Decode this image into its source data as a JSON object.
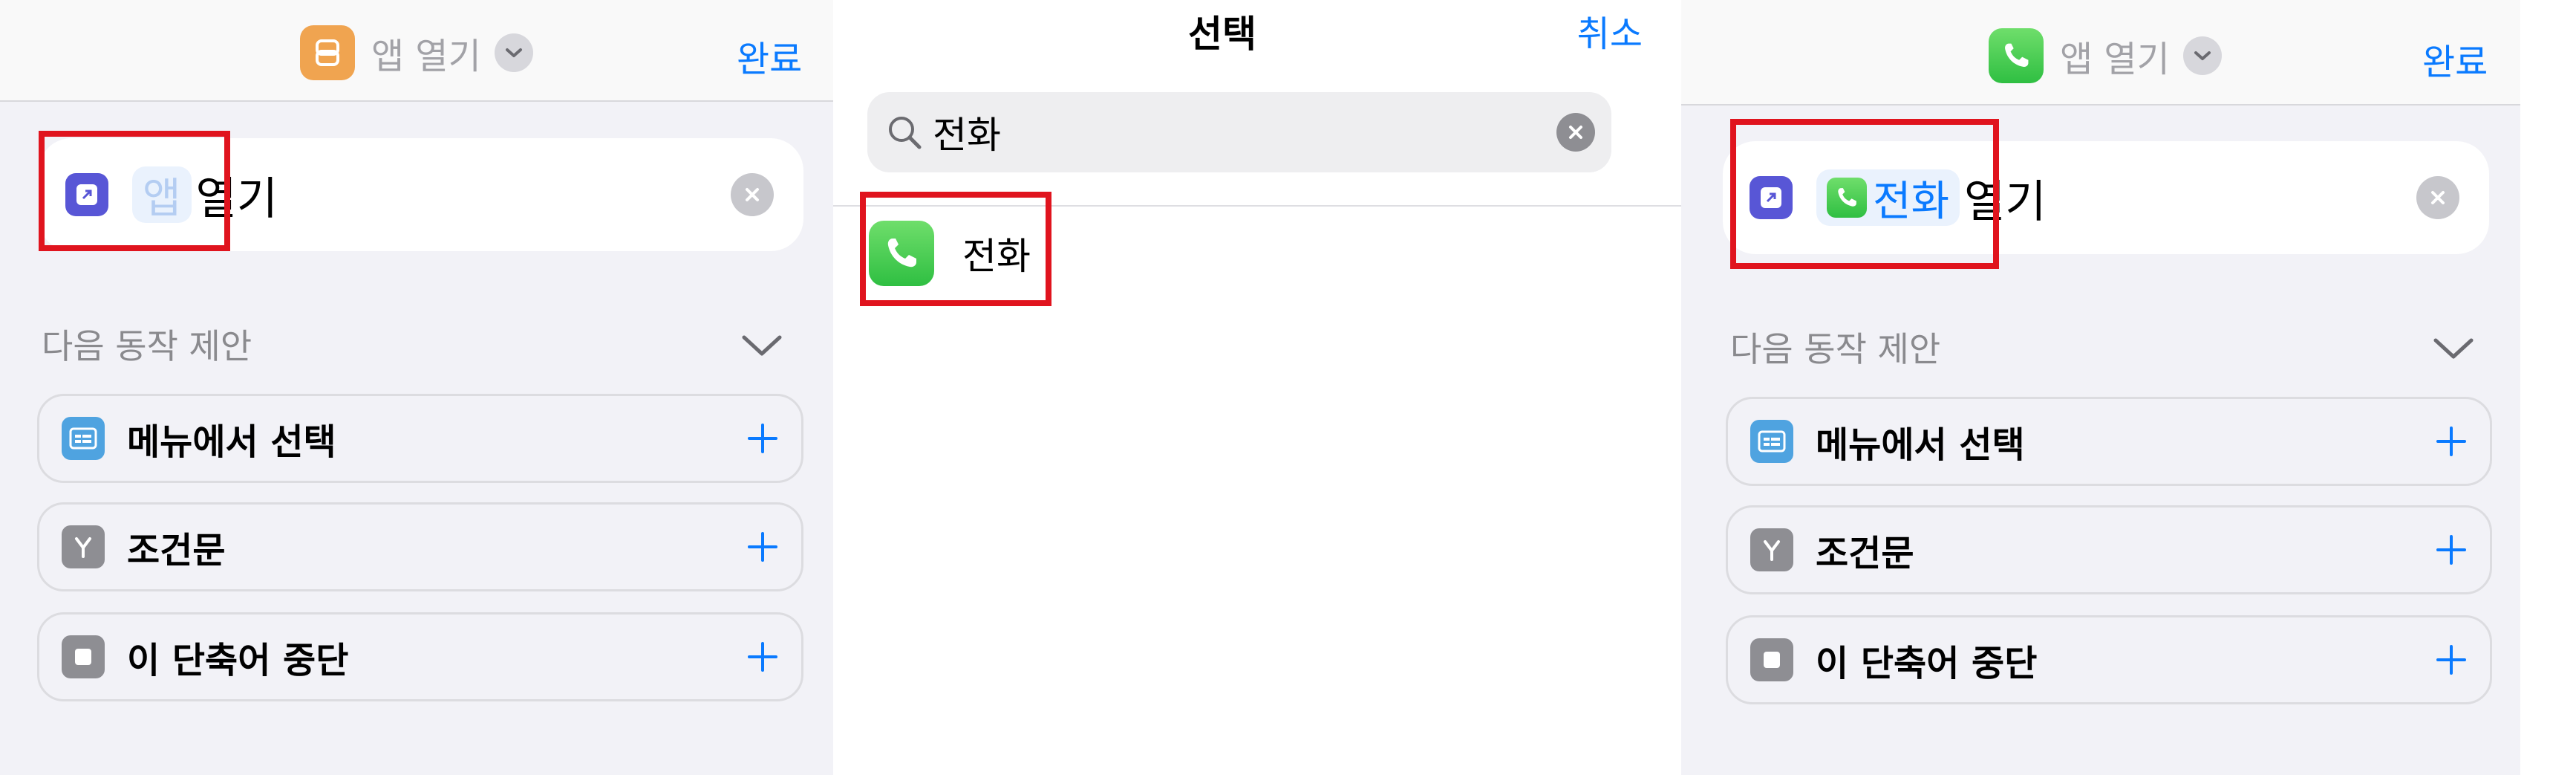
{
  "colors": {
    "accent": "#0a7aff",
    "highlight": "#e0141e",
    "shortcut_icon": "#5856d6"
  },
  "panel_before": {
    "nav": {
      "app_icon": "shortcuts-app-icon",
      "title": "앱 열기",
      "done": "완료"
    },
    "action": {
      "icon": "open-app-icon",
      "token": "앱",
      "text": "열기"
    },
    "suggestions_title": "다음 동작 제안",
    "suggestions": [
      {
        "icon": "menu-icon",
        "label": "메뉴에서 선택"
      },
      {
        "icon": "branch-icon",
        "label": "조건문"
      },
      {
        "icon": "stop-icon",
        "label": "이 단축어 중단"
      }
    ]
  },
  "panel_search": {
    "title": "선택",
    "cancel": "취소",
    "search": {
      "value": "전화",
      "placeholder": ""
    },
    "results": [
      {
        "icon": "phone-app-icon",
        "label": "전화"
      }
    ]
  },
  "panel_after": {
    "nav": {
      "app_icon": "phone-app-icon",
      "title": "앱 열기",
      "done": "완료"
    },
    "action": {
      "icon": "open-app-icon",
      "token": "전화",
      "text": "열기"
    },
    "suggestions_title": "다음 동작 제안",
    "suggestions": [
      {
        "icon": "menu-icon",
        "label": "메뉴에서 선택"
      },
      {
        "icon": "branch-icon",
        "label": "조건문"
      },
      {
        "icon": "stop-icon",
        "label": "이 단축어 중단"
      }
    ]
  }
}
